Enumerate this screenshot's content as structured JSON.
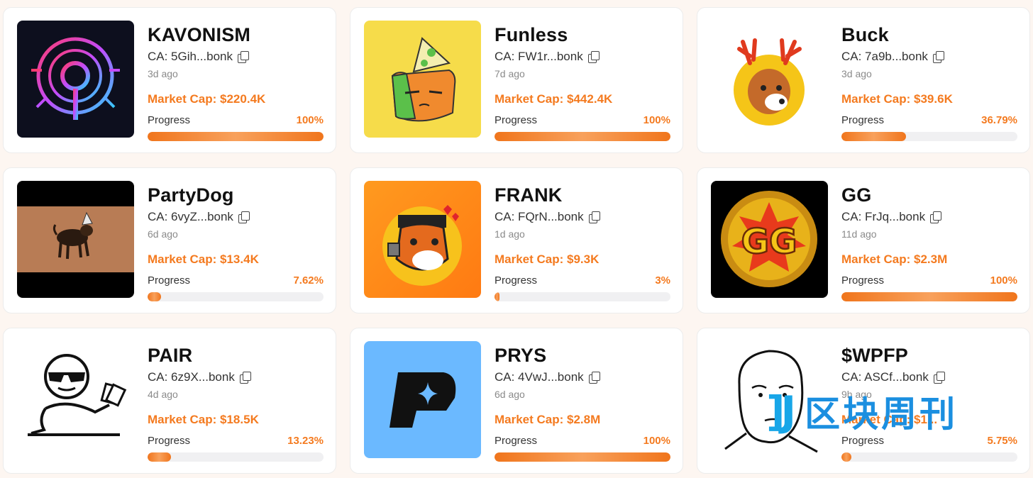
{
  "labels": {
    "progress": "Progress"
  },
  "tokens": [
    {
      "name": "KAVONISM",
      "ca": "CA: 5Gih...bonk",
      "age": "3d ago",
      "market_cap": "Market Cap: $220.4K",
      "progress": "100%",
      "progress_value": 100,
      "image": "neon-brain-circuit"
    },
    {
      "name": "Funless",
      "ca": "CA: FW1r...bonk",
      "age": "7d ago",
      "market_cap": "Market Cap: $442.4K",
      "progress": "100%",
      "progress_value": 100,
      "image": "grumpy-cat-party-hat"
    },
    {
      "name": "Buck",
      "ca": "CA: 7a9b...bonk",
      "age": "3d ago",
      "market_cap": "Market Cap: $39.6K",
      "progress": "36.79%",
      "progress_value": 36.79,
      "image": "deer-with-antlers"
    },
    {
      "name": "PartyDog",
      "ca": "CA: 6vyZ...bonk",
      "age": "6d ago",
      "market_cap": "Market Cap: $13.4K",
      "progress": "7.62%",
      "progress_value": 7.62,
      "image": "dog-party-hat"
    },
    {
      "name": "FRANK",
      "ca": "CA: FQrN...bonk",
      "age": "1d ago",
      "market_cap": "Market Cap: $9.3K",
      "progress": "3%",
      "progress_value": 3,
      "image": "frankenstein-shiba"
    },
    {
      "name": "GG",
      "ca": "CA: FrJq...bonk",
      "age": "11d ago",
      "market_cap": "Market Cap: $2.3M",
      "progress": "100%",
      "progress_value": 100,
      "image": "gg-gold-coin"
    },
    {
      "name": "PAIR",
      "ca": "CA: 6z9X...bonk",
      "age": "4d ago",
      "market_cap": "Market Cap: $18.5K",
      "progress": "13.23%",
      "progress_value": 13.23,
      "image": "sunglasses-cards-guy"
    },
    {
      "name": "PRYS",
      "ca": "CA: 4VwJ...bonk",
      "age": "6d ago",
      "market_cap": "Market Cap: $2.8M",
      "progress": "100%",
      "progress_value": 100,
      "image": "p-star-logo"
    },
    {
      "name": "$WPFP",
      "ca": "CA: ASCf...bonk",
      "age": "9h ago",
      "market_cap": "Market Cap: $1...",
      "progress": "5.75%",
      "progress_value": 5.75,
      "image": "wojak-face"
    }
  ],
  "watermark": {
    "logo": "]J",
    "text": "区块周刊"
  },
  "colors": {
    "accent": "#f47a1f",
    "bar_track": "#f0f0f2",
    "watermark": "#1b8fe0"
  }
}
